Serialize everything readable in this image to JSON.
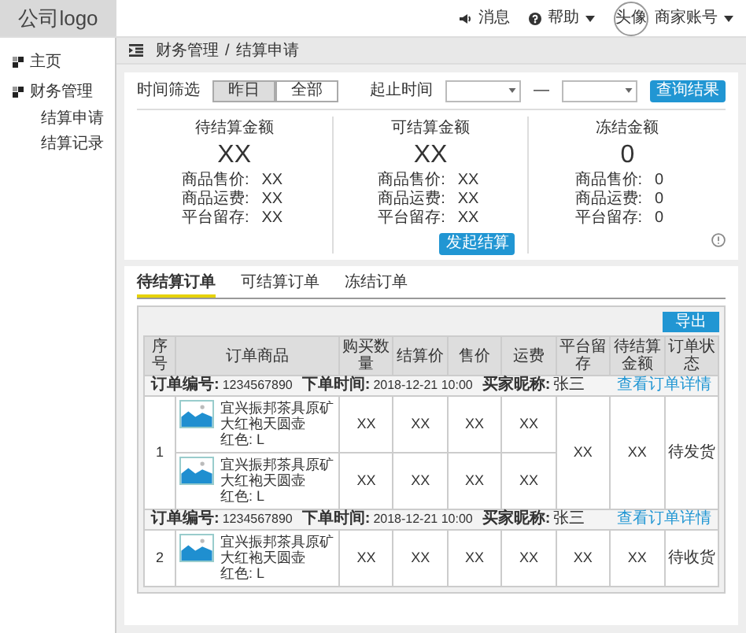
{
  "header": {
    "logo": "公司logo",
    "messages": "消息",
    "help": "帮助",
    "avatar": "头像",
    "account": "商家账号"
  },
  "sidebar": {
    "items": [
      {
        "label": "主页"
      },
      {
        "label": "财务管理",
        "children": [
          {
            "label": "结算申请"
          },
          {
            "label": "结算记录"
          }
        ]
      }
    ]
  },
  "breadcrumb": [
    "财务管理",
    "/",
    "结算申请"
  ],
  "filter": {
    "label": "时间筛选",
    "options": [
      {
        "label": "昨日",
        "selected": true
      },
      {
        "label": "全部",
        "selected": false
      }
    ],
    "range_label": "起止时间",
    "separator": "—",
    "query_button": "查询结果"
  },
  "summary": [
    {
      "title": "待结算金额",
      "amount": "XX",
      "lines": [
        {
          "label": "商品售价:",
          "value": "XX"
        },
        {
          "label": "商品运费:",
          "value": "XX"
        },
        {
          "label": "平台留存:",
          "value": "XX"
        }
      ]
    },
    {
      "title": "可结算金额",
      "amount": "XX",
      "lines": [
        {
          "label": "商品售价:",
          "value": "XX"
        },
        {
          "label": "商品运费:",
          "value": "XX"
        },
        {
          "label": "平台留存:",
          "value": "XX"
        }
      ],
      "button": "发起结算"
    },
    {
      "title": "冻结金额",
      "amount": "0",
      "lines": [
        {
          "label": "商品售价:",
          "value": "0"
        },
        {
          "label": "商品运费:",
          "value": "0"
        },
        {
          "label": "平台留存:",
          "value": "0"
        }
      ]
    }
  ],
  "tabs": [
    {
      "label": "待结算订单",
      "selected": true
    },
    {
      "label": "可结算订单",
      "selected": false
    },
    {
      "label": "冻结订单",
      "selected": false
    }
  ],
  "export_button": "导出",
  "table": {
    "columns": [
      "序号",
      "订单商品",
      "购买数量",
      "结算价",
      "售价",
      "运费",
      "平台留存",
      "待结算金额",
      "订单状态"
    ],
    "orders": [
      {
        "seq": "1",
        "order_no_label": "订单编号:",
        "order_no": "1234567890",
        "time_label": "下单时间:",
        "time": "2018-12-21 10:00",
        "buyer_label": "买家昵称:",
        "buyer": "张三",
        "detail_link": "查看订单详情",
        "retained": "XX",
        "settle_amount": "XX",
        "status": "待发货",
        "items": [
          {
            "name": "宜兴振邦茶具原矿大红袍天圆壶",
            "spec": "红色: L",
            "quantity": "XX",
            "settle_price": "XX",
            "price": "XX",
            "freight": "XX"
          },
          {
            "name": "宜兴振邦茶具原矿大红袍天圆壶",
            "spec": "红色: L",
            "quantity": "XX",
            "settle_price": "XX",
            "price": "XX",
            "freight": "XX"
          }
        ]
      },
      {
        "seq": "2",
        "order_no_label": "订单编号:",
        "order_no": "1234567890",
        "time_label": "下单时间:",
        "time": "2018-12-21 10:00",
        "buyer_label": "买家昵称:",
        "buyer": "张三",
        "detail_link": "查看订单详情",
        "retained": "XX",
        "settle_amount": "XX",
        "status": "待收货",
        "items": [
          {
            "name": "宜兴振邦茶具原矿大红袍天圆壶",
            "spec": "红色: L",
            "quantity": "XX",
            "settle_price": "XX",
            "price": "XX",
            "freight": "XX"
          }
        ]
      }
    ]
  }
}
